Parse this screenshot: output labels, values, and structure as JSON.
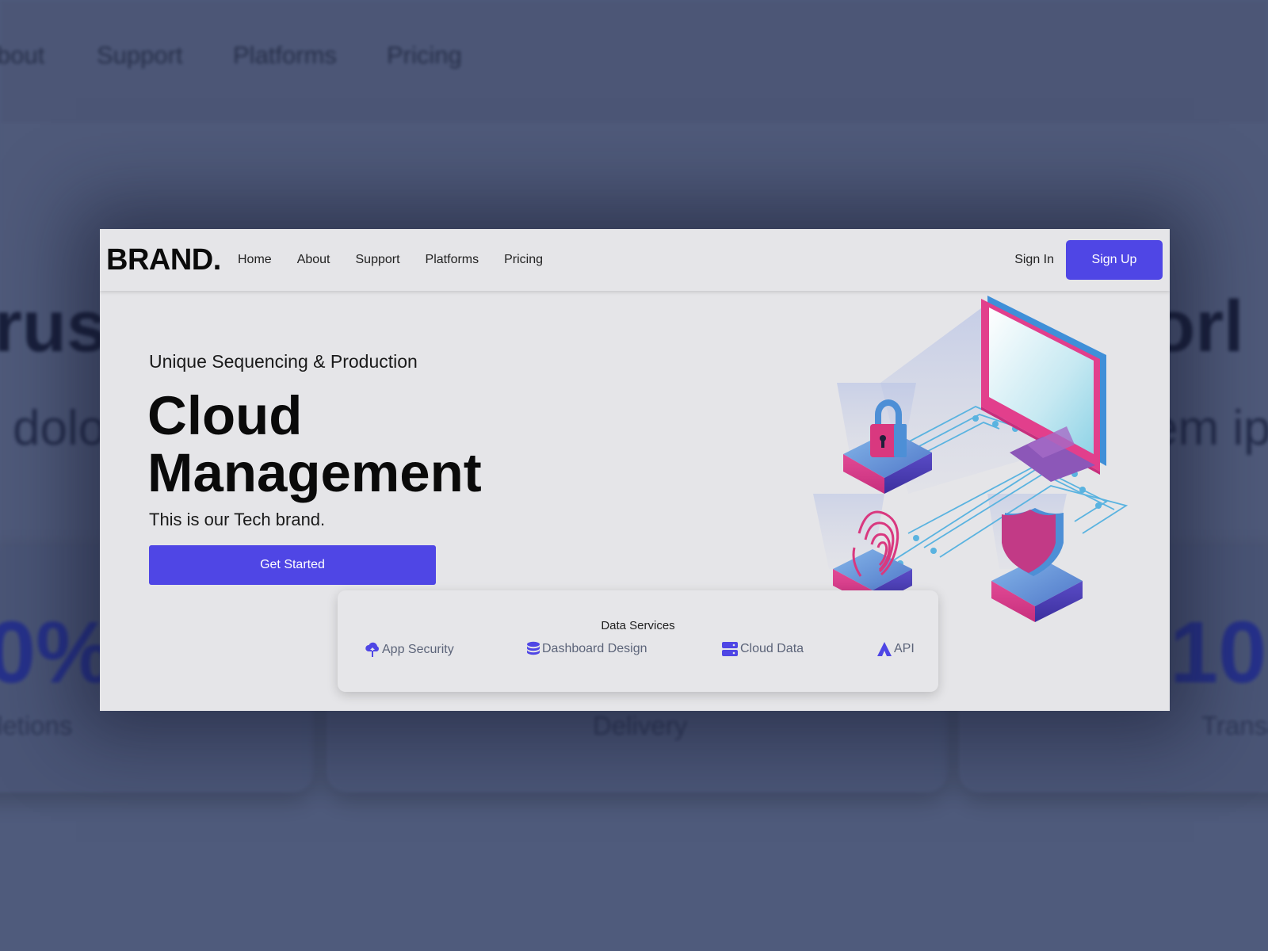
{
  "background": {
    "nav_items": [
      "bout",
      "Support",
      "Platforms",
      "Pricing"
    ],
    "headline_left": "rus",
    "headline_right": "orl",
    "sub_left": "dolo",
    "sub_right": "em ip",
    "stats": [
      {
        "value": "0%",
        "label": "letions"
      },
      {
        "value": "",
        "label": "Delivery"
      },
      {
        "value": "10",
        "label": "Transa"
      }
    ]
  },
  "navbar": {
    "brand": "BRAND.",
    "links": [
      "Home",
      "About",
      "Support",
      "Platforms",
      "Pricing"
    ],
    "sign_in": "Sign In",
    "sign_up": "Sign Up"
  },
  "hero": {
    "eyebrow": "Unique Sequencing & Production",
    "title_line1": "Cloud",
    "title_line2": "Management",
    "description": "This is our Tech brand.",
    "cta": "Get Started"
  },
  "services": {
    "title": "Data Services",
    "items": [
      {
        "label": "App Security",
        "icon": "cloud-upload-icon"
      },
      {
        "label": "Dashboard Design",
        "icon": "database-icon"
      },
      {
        "label": "Cloud Data",
        "icon": "server-icon"
      },
      {
        "label": "API",
        "icon": "triangle-logo-icon"
      }
    ]
  },
  "colors": {
    "accent": "#4f46e5",
    "page_bg": "#e5e5e8",
    "backdrop": "#4f5b7c"
  }
}
